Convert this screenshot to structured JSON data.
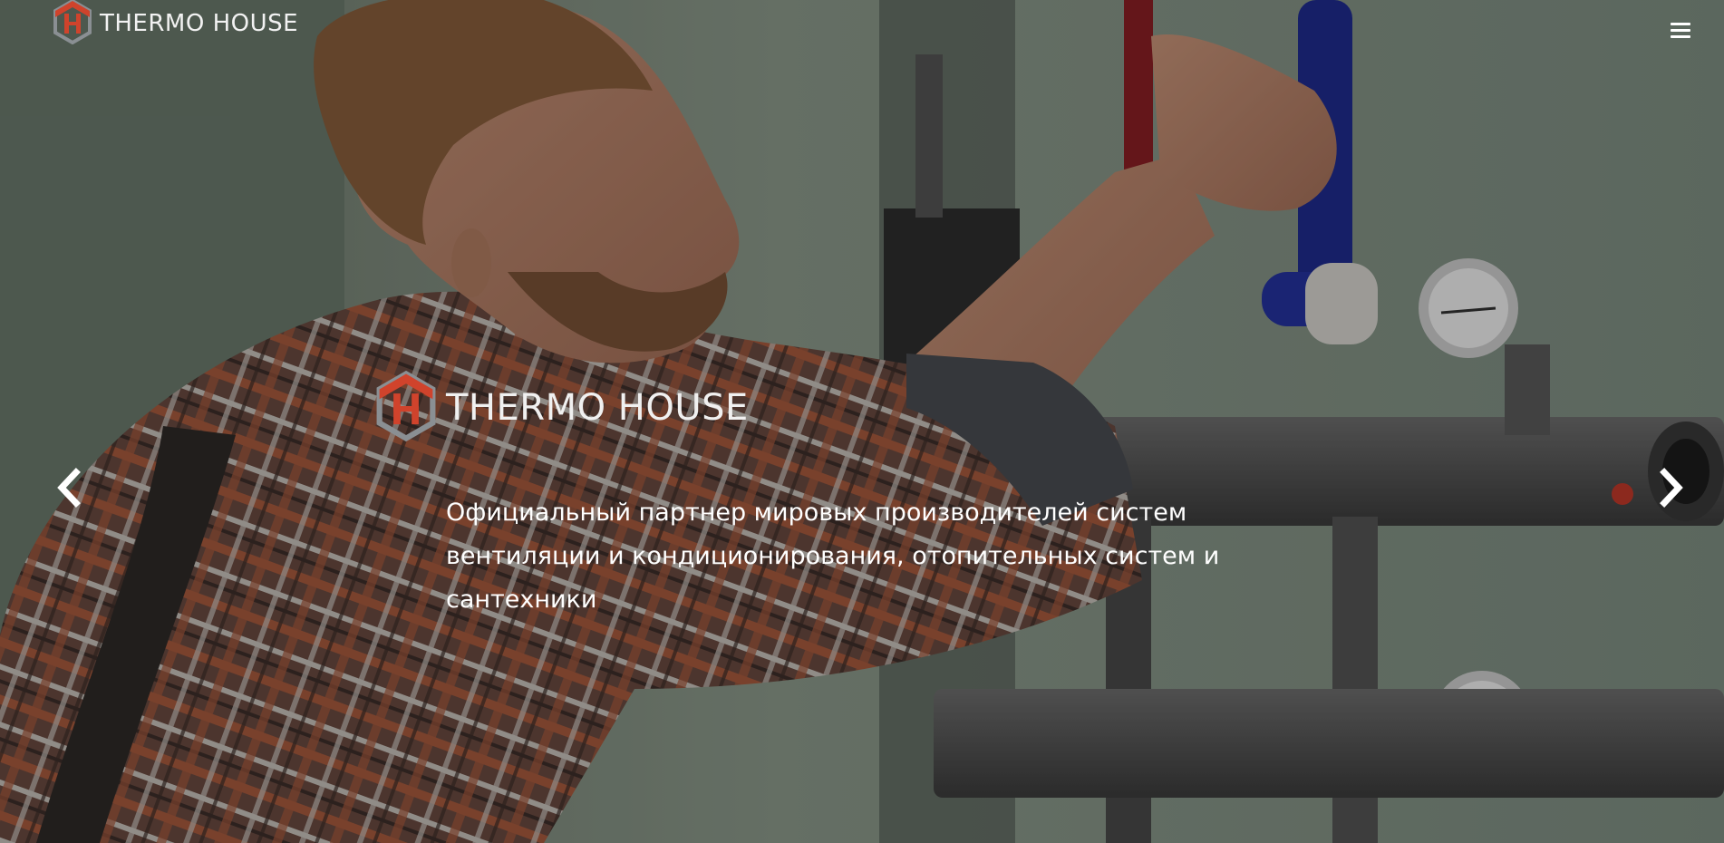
{
  "header": {
    "brand_name": "THERMO HOUSE",
    "logo_icon": "thermo-house-logo-icon",
    "menu_icon": "hamburger-menu-icon"
  },
  "slide": {
    "brand_name": "THERMO HOUSE",
    "logo_icon": "thermo-house-logo-icon",
    "text": "Официальный партнер мировых производителей систем вентиляции и кондиционирования, отопительных систем и сантехники",
    "prev_icon": "chevron-left-icon",
    "next_icon": "chevron-right-icon"
  },
  "colors": {
    "logo_red": "#d0432c",
    "logo_gray": "#8a8f93",
    "text": "#ffffff"
  }
}
